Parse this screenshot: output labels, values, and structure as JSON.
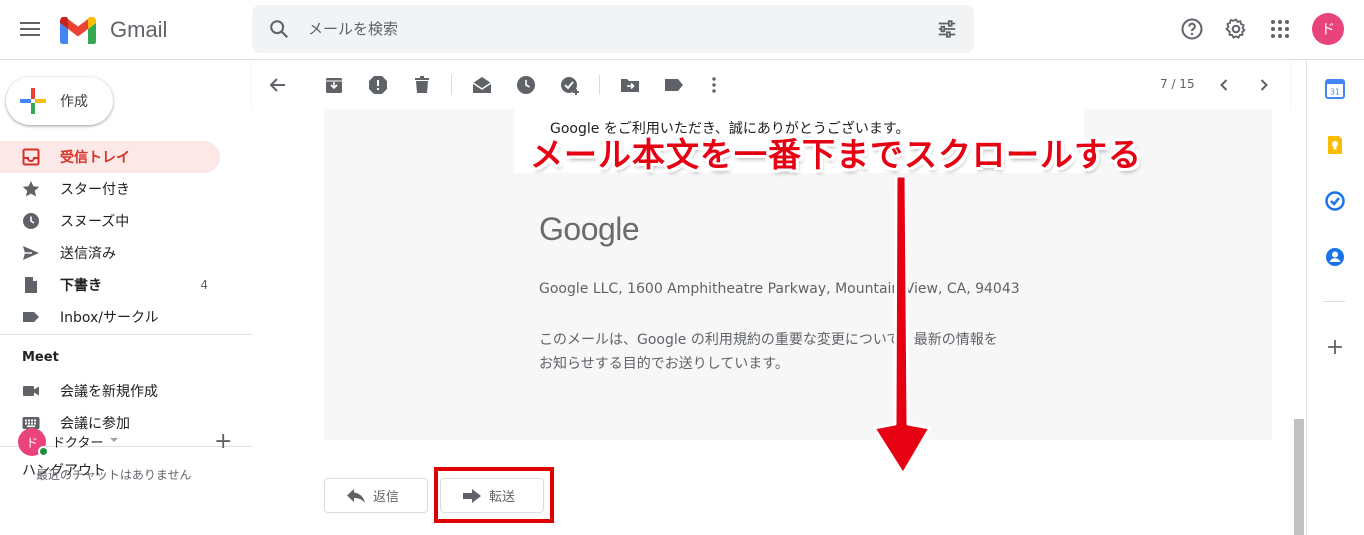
{
  "header": {
    "app_name": "Gmail",
    "search_placeholder": "メールを検索",
    "avatar_initial": "ド"
  },
  "sidebar": {
    "compose_label": "作成",
    "items": [
      {
        "label": "受信トレイ",
        "count": "",
        "icon": "inbox-icon"
      },
      {
        "label": "スター付き",
        "count": "",
        "icon": "star-icon"
      },
      {
        "label": "スヌーズ中",
        "count": "",
        "icon": "clock-icon"
      },
      {
        "label": "送信済み",
        "count": "",
        "icon": "send-icon"
      },
      {
        "label": "下書き",
        "count": "4",
        "icon": "draft-icon"
      },
      {
        "label": "Inbox/サークル",
        "count": "",
        "icon": "label-icon"
      }
    ],
    "meet": {
      "title": "Meet",
      "items": [
        {
          "label": "会議を新規作成",
          "icon": "video-icon"
        },
        {
          "label": "会議に参加",
          "icon": "keyboard-icon"
        }
      ]
    },
    "hangouts": {
      "title": "ハングアウト",
      "user": "ドクター",
      "user_initial": "ド",
      "empty_text": "最近のチャットはありません"
    }
  },
  "toolbar": {
    "pager": "7 / 15"
  },
  "email": {
    "thanks": "Google をご利用いただき、誠にありがとうございます。",
    "logo_text": "Google",
    "address": "Google LLC, 1600 Amphitheatre Parkway, Mountain View, CA, 94043",
    "notice_line1": "このメールは、Google の利用規約の重要な変更について、最新の情報を",
    "notice_line2": "お知らせする目的でお送りしています。",
    "reply_label": "返信",
    "forward_label": "転送"
  },
  "annotation": {
    "text": "メール本文を一番下までスクロールする",
    "color": "#e60012"
  },
  "colors": {
    "accent_red": "#d93025",
    "active_bg": "#fce8e6",
    "highlight": "#e00000"
  }
}
